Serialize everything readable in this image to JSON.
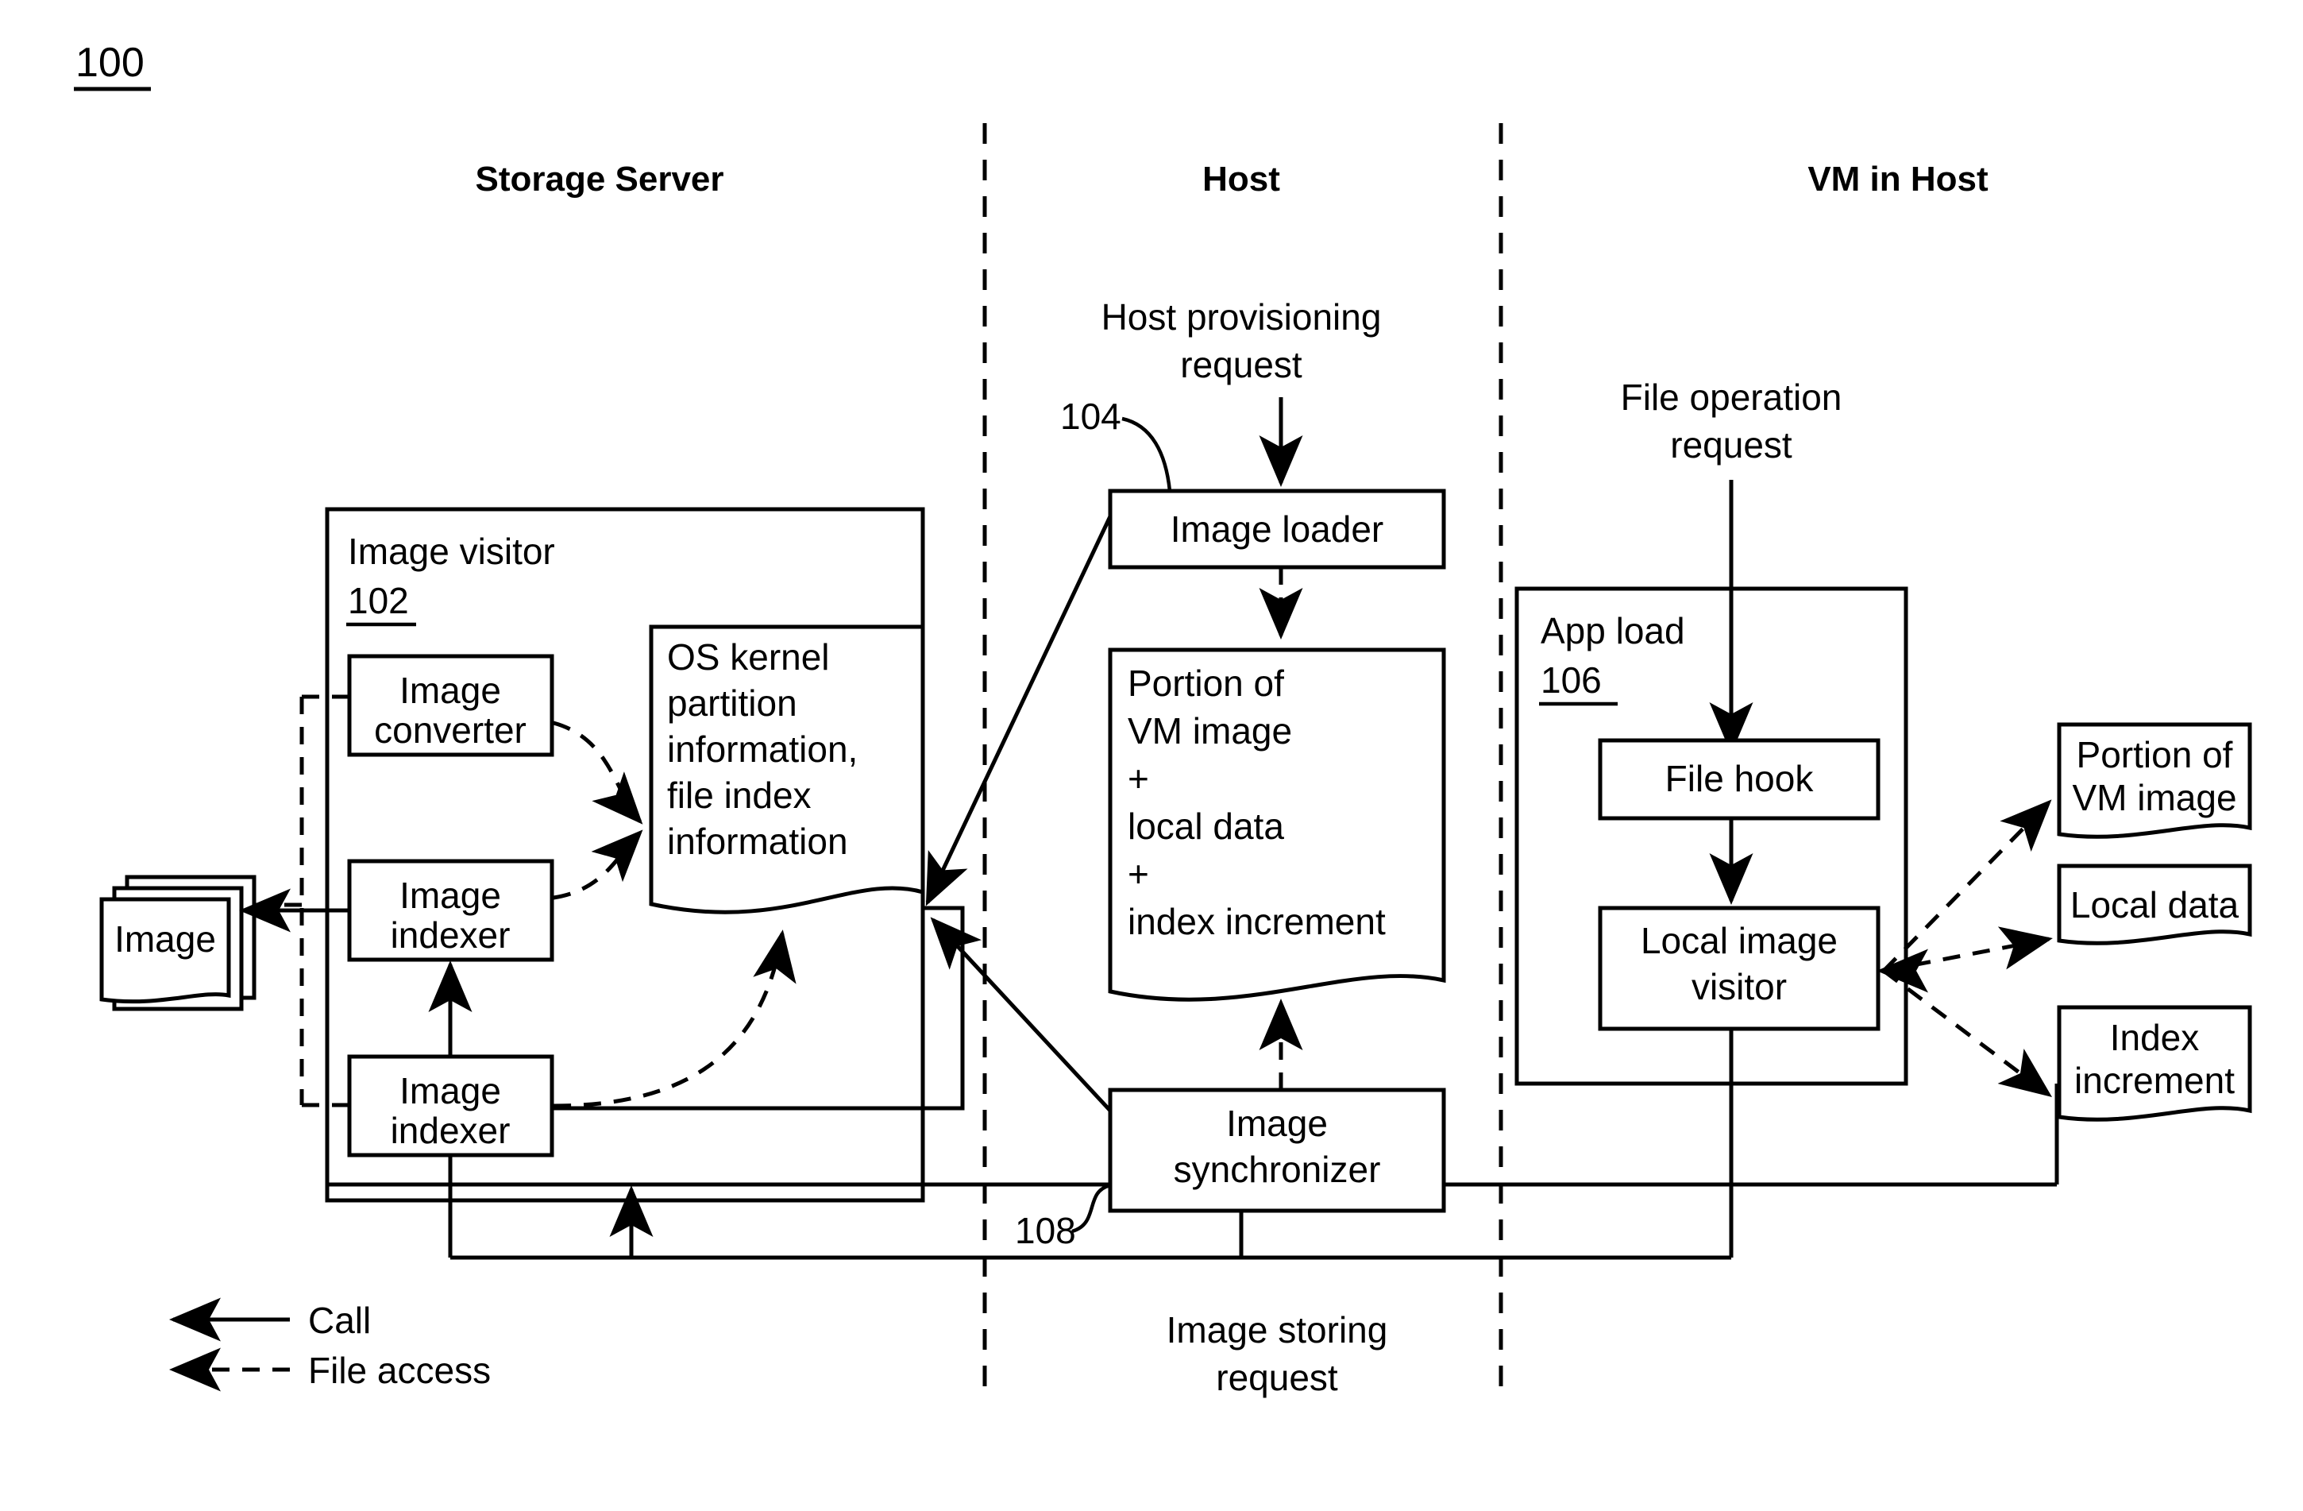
{
  "figure": {
    "number": "100"
  },
  "columns": [
    {
      "id": "storage-server",
      "label": "Storage Server"
    },
    {
      "id": "host",
      "label": "Host"
    },
    {
      "id": "vm-in-host",
      "label": "VM in Host"
    }
  ],
  "storage_server": {
    "container": {
      "title": "Image visitor",
      "ref": "102"
    },
    "image_stack": {
      "label": "Image"
    },
    "boxes": [
      {
        "id": "image-converter",
        "label": "Image\nconverter"
      },
      {
        "id": "image-indexer-upper",
        "label": "Image\nindexer"
      },
      {
        "id": "image-indexer-lower",
        "label": "Image\nindexer"
      }
    ],
    "os_kernel_doc": {
      "label": "OS kernel\npartition\ninformation,\nfile index\ninformation"
    }
  },
  "host": {
    "annotations": [
      {
        "id": "host-provisioning-request",
        "label": "Host provisioning\nrequest"
      },
      {
        "id": "image-storing-request",
        "label": "Image storing\nrequest"
      }
    ],
    "image_loader": {
      "label": "Image loader",
      "ref": "104"
    },
    "portion_doc": {
      "label": "Portion of\nVM image\n+\nlocal data\n+\nindex increment"
    },
    "image_synchronizer": {
      "label": "Image\nsynchronizer",
      "ref": "108"
    }
  },
  "vm_in_host": {
    "annotations": [
      {
        "id": "file-operation-request",
        "label": "File operation\nrequest"
      }
    ],
    "app_load": {
      "title": "App load",
      "ref": "106"
    },
    "boxes": [
      {
        "id": "file-hook",
        "label": "File hook"
      },
      {
        "id": "local-image-visitor",
        "label": "Local image\nvisitor"
      }
    ],
    "outputs": [
      {
        "id": "portion-of-vm-image",
        "label": "Portion of\nVM image"
      },
      {
        "id": "local-data",
        "label": "Local data"
      },
      {
        "id": "index-increment",
        "label": "Index\nincrement"
      }
    ]
  },
  "legend": [
    {
      "id": "call",
      "label": "Call",
      "style": "solid"
    },
    {
      "id": "file-access",
      "label": "File access",
      "style": "dashed"
    }
  ],
  "colors": {
    "stroke": "#000000",
    "background": "#ffffff"
  }
}
